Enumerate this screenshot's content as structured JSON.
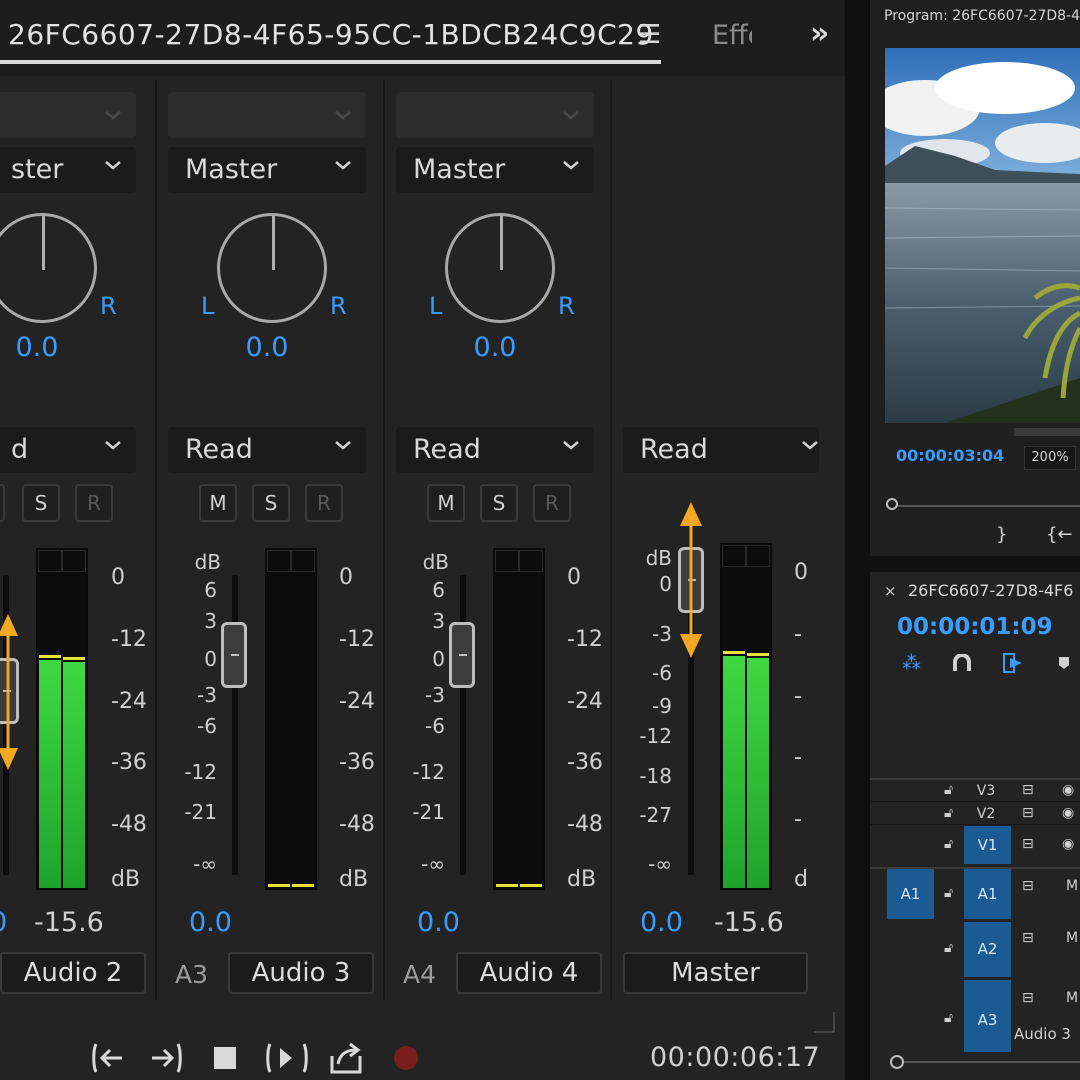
{
  "mixer": {
    "sequence_tab": "26FC6607-27D8-4F65-95CC-1BDCB24C9C29",
    "menu_icon": "hamburger-icon",
    "effects_tab": "Effe",
    "more_icon": "double-chevron-right-icon",
    "channels": [
      {
        "id": "a2",
        "output": "ster",
        "automation": "d",
        "L": "",
        "R": "R",
        "pan": "0.0",
        "volume": "0",
        "peak": "-15.6",
        "tag": "",
        "name": "Audio 2",
        "meter_level": 0.74,
        "m": "",
        "s": "S",
        "r": "R"
      },
      {
        "id": "a3",
        "output": "Master",
        "automation": "Read",
        "L": "L",
        "R": "R",
        "pan": "0.0",
        "volume": "0.0",
        "peak": "",
        "tag": "A3",
        "name": "Audio 3",
        "meter_level": 0,
        "m": "M",
        "s": "S",
        "r": "R"
      },
      {
        "id": "a4",
        "output": "Master",
        "automation": "Read",
        "L": "L",
        "R": "R",
        "pan": "0.0",
        "volume": "0.0",
        "peak": "",
        "tag": "A4",
        "name": "Audio 4",
        "meter_level": 0,
        "m": "M",
        "s": "S",
        "r": "R"
      },
      {
        "id": "master",
        "automation": "Read",
        "volume": "0.0",
        "peak": "-15.6",
        "name": "Master",
        "meter_level": 0.74
      }
    ],
    "fader_scale": [
      "dB",
      "6",
      "3",
      "0",
      "-3",
      "-6",
      "-12",
      "-21",
      "-∞"
    ],
    "master_fader_scale": [
      "dB",
      "0",
      "-3",
      "-6",
      "-9",
      "-12",
      "-18",
      "-27",
      "-∞"
    ],
    "meter_scale": [
      "0",
      "-12",
      "-24",
      "-36",
      "-48",
      "dB"
    ],
    "master_meter_scale": [
      "0",
      "-",
      "-",
      "-",
      "-",
      "d"
    ],
    "transport_icons": [
      "go-to-in-icon",
      "go-to-out-icon",
      "stop-icon",
      "loop-icon",
      "export-icon",
      "record-icon"
    ],
    "timecode": "00:00:06:17",
    "colors": {
      "accent_blue": "#3a9cff",
      "meter_green": "#3fd843",
      "annotation_orange": "#f5a623",
      "record_red": "#7a1d1d"
    }
  },
  "program": {
    "title": "Program: 26FC6607-27D8-4",
    "timecode": "00:00:03:04",
    "zoom": "200%"
  },
  "timeline": {
    "title": "26FC6607-27D8-4F6",
    "timecode": "00:00:01:09",
    "tools": [
      "snap-icon",
      "magnet-icon",
      "linked-selection-icon",
      "marker-icon"
    ],
    "tracks": [
      {
        "src": "",
        "name": "V3",
        "targeted": false,
        "extra": ""
      },
      {
        "src": "",
        "name": "V2",
        "targeted": false,
        "extra": ""
      },
      {
        "src": "",
        "name": "V1",
        "targeted": true,
        "extra": ""
      },
      {
        "src": "A1",
        "name": "A1",
        "targeted": true,
        "extra": "M"
      },
      {
        "src": "",
        "name": "A2",
        "targeted": true,
        "extra": "M"
      },
      {
        "src": "",
        "name": "A3",
        "targeted": true,
        "extra": "M"
      }
    ],
    "track_label": "Audio 3"
  }
}
